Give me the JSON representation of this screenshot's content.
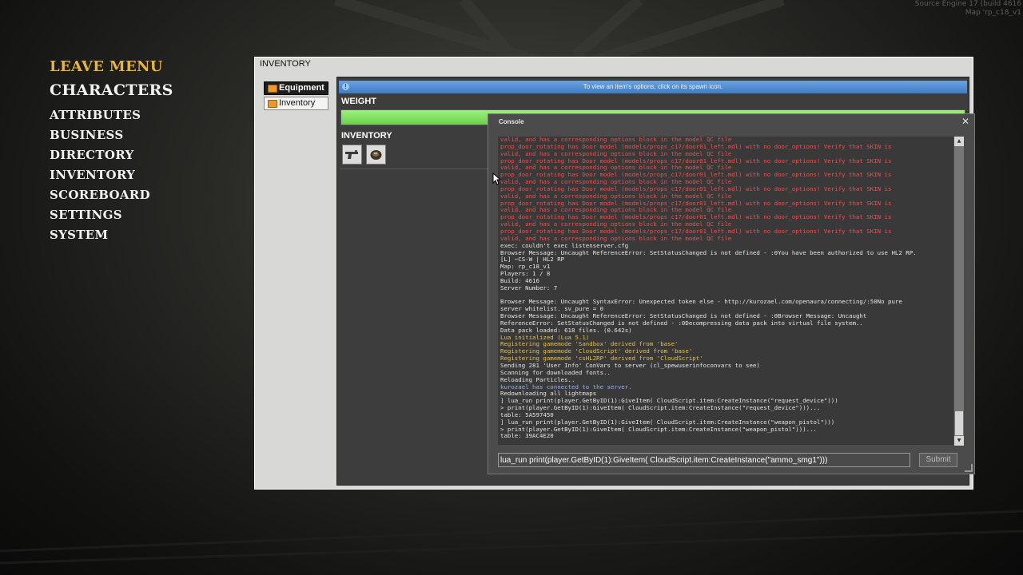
{
  "engine": {
    "version": "Source Engine 17 (build 4616",
    "map": "Map 'rp_c18_v1"
  },
  "menu": {
    "items": [
      {
        "label": "LEAVE MENU"
      },
      {
        "label": "CHARACTERS"
      },
      {
        "label": "ATTRIBUTES"
      },
      {
        "label": "BUSINESS"
      },
      {
        "label": "DIRECTORY"
      },
      {
        "label": "INVENTORY"
      },
      {
        "label": "SCOREBOARD"
      },
      {
        "label": "SETTINGS"
      },
      {
        "label": "SYSTEM"
      }
    ]
  },
  "inventory_window": {
    "title": "INVENTORY",
    "tabs": [
      {
        "label": "Equipment",
        "icon": "folder-icon"
      },
      {
        "label": "Inventory",
        "icon": "folder-icon"
      }
    ],
    "info_text": "To view an item's options, click on its spawn icon.",
    "weight_label": "WEIGHT",
    "weight_fraction": 1.0,
    "inventory_label": "INVENTORY",
    "items": [
      {
        "icon": "pistol-icon"
      },
      {
        "icon": "request-device-icon"
      }
    ]
  },
  "console": {
    "title": "Console",
    "colors": {
      "red": "#ef4f4f",
      "white": "#e6e6e6",
      "yellow": "#e8c23a",
      "blue": "#90b4ef"
    },
    "lines": [
      {
        "c": "red",
        "t": "valid, and has a corresponding options block in the model QC file"
      },
      {
        "c": "red",
        "t": "prop_door_rotating has Door model (models/props_c17/door01_left.mdl) with no door_options! Verify that SKIN is"
      },
      {
        "c": "red",
        "t": "valid, and has a corresponding options block in the model QC file"
      },
      {
        "c": "red",
        "t": "prop_door_rotating has Door model (models/props_c17/door01_left.mdl) with no door_options! Verify that SKIN is"
      },
      {
        "c": "red",
        "t": "valid, and has a corresponding options block in the model QC file"
      },
      {
        "c": "red",
        "t": "prop_door_rotating has Door model (models/props_c17/door01_left.mdl) with no door_options! Verify that SKIN is"
      },
      {
        "c": "red",
        "t": "valid, and has a corresponding options block in the model QC file"
      },
      {
        "c": "red",
        "t": "prop_door_rotating has Door model (models/props_c17/door01_left.mdl) with no door_options! Verify that SKIN is"
      },
      {
        "c": "red",
        "t": "valid, and has a corresponding options block in the model QC file"
      },
      {
        "c": "red",
        "t": "prop_door_rotating has Door model (models/props_c17/door01_left.mdl) with no door_options! Verify that SKIN is"
      },
      {
        "c": "red",
        "t": "valid, and has a corresponding options block in the model QC file"
      },
      {
        "c": "red",
        "t": "prop_door_rotating has Door model (models/props_c17/door01_left.mdl) with no door_options! Verify that SKIN is"
      },
      {
        "c": "red",
        "t": "valid, and has a corresponding options block in the model QC file"
      },
      {
        "c": "red",
        "t": "prop_door_rotating has Door model (models/props_c17/door01_left.mdl) with no door_options! Verify that SKIN is"
      },
      {
        "c": "red",
        "t": "valid, and has a corresponding options block in the model QC file"
      },
      {
        "c": "white",
        "t": "exec: couldn't exec listenserver.cfg"
      },
      {
        "c": "white",
        "t": "Browser Message: Uncaught ReferenceError: SetStatusChanged is not defined - :0You have been authorized to use HL2 RP."
      },
      {
        "c": "white",
        "t": "[L] ~CS-W | HL2 RP"
      },
      {
        "c": "white",
        "t": "Map: rp_c18_v1"
      },
      {
        "c": "white",
        "t": "Players: 1 / 8"
      },
      {
        "c": "white",
        "t": "Build: 4616"
      },
      {
        "c": "white",
        "t": "Server Number: 7"
      },
      {
        "c": "white",
        "t": " "
      },
      {
        "c": "white",
        "t": "Browser Message: Uncaught SyntaxError: Unexpected token else - http://kurozael.com/openaura/connecting/:50No pure"
      },
      {
        "c": "white",
        "t": "server whitelist. sv_pure = 0"
      },
      {
        "c": "white",
        "t": "Browser Message: Uncaught ReferenceError: SetStatusChanged is not defined - :0Browser Message: Uncaught"
      },
      {
        "c": "white",
        "t": "ReferenceError: SetStatusChanged is not defined - :0Decompressing data pack into virtual file system.."
      },
      {
        "c": "white",
        "t": "Data pack loaded: 618 files. (0.642s)"
      },
      {
        "c": "yellow",
        "t": "Lua initialized (Lua 5.1)"
      },
      {
        "c": "yellow",
        "t": "Registering gamemode 'Sandbox' derived from 'base'"
      },
      {
        "c": "yellow",
        "t": "Registering gamemode 'CloudScript' derived from 'base'"
      },
      {
        "c": "yellow",
        "t": "Registering gamemode 'csHL2RP' derived from 'CloudScript'"
      },
      {
        "c": "white",
        "t": "Sending 281 'User Info' ConVars to server (cl_spewuserinfoconvars to see)"
      },
      {
        "c": "white",
        "t": "Scanning for downloaded fonts.."
      },
      {
        "c": "white",
        "t": "Reloading Particles.."
      },
      {
        "c": "blue",
        "t": "kurozael has connected to the server."
      },
      {
        "c": "white",
        "t": "Redownloading all lightmaps"
      },
      {
        "c": "white",
        "t": "] lua_run print(player.GetByID(1):GiveItem( CloudScript.item:CreateInstance(\"request_device\")))"
      },
      {
        "c": "white",
        "t": "> print(player.GetByID(1):GiveItem( CloudScript.item:CreateInstance(\"request_device\")))..."
      },
      {
        "c": "white",
        "t": "table: 5A597450"
      },
      {
        "c": "white",
        "t": "] lua_run print(player.GetByID(1):GiveItem( CloudScript.item:CreateInstance(\"weapon_pistol\")))"
      },
      {
        "c": "white",
        "t": "> print(player.GetByID(1):GiveItem( CloudScript.item:CreateInstance(\"weapon_pistol\")))..."
      },
      {
        "c": "white",
        "t": "table: 39AC4E20"
      }
    ],
    "input_value": "lua_run print(player.GetByID(1):GiveItem( CloudScript.item:CreateInstance(\"ammo_smg1\")))",
    "submit_label": "Submit"
  }
}
